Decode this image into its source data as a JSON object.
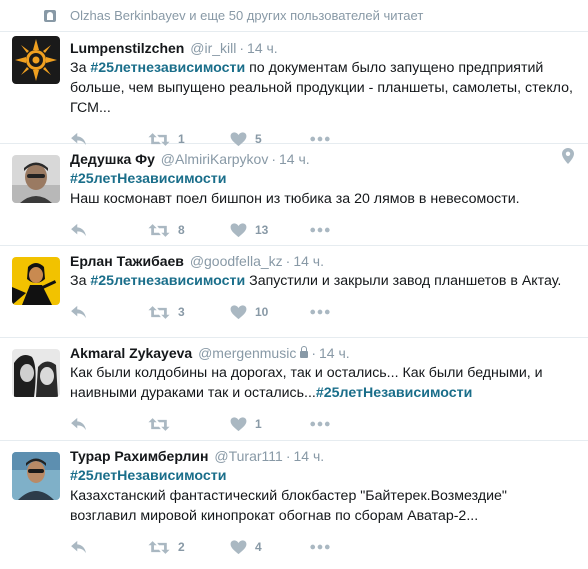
{
  "header": {
    "followers_text": "Olzhas Berkinbayev и еще 50 других пользователей читает"
  },
  "tweets": [
    {
      "name": "Lumpenstilzchen",
      "handle": "@ir_kill",
      "time": "14 ч.",
      "text_before": "За ",
      "hashtag": "#25летнезависимости",
      "text_after": " по документам было запущено предприятий больше, чем выпущено реальной продукции - планшеты, самолеты, стекло, ГСМ...",
      "retweets": "1",
      "likes": "5"
    },
    {
      "name": "Дедушка Фу",
      "handle": "@AlmiriKarpykov",
      "time": "14 ч.",
      "text_before": "",
      "hashtag": "#25летНезависимости",
      "text_after": "Наш космонавт поел бишпон из тюбика за 20 лямов в невесомости.",
      "retweets": "8",
      "likes": "13"
    },
    {
      "name": "Ерлан Тажибаев",
      "handle": "@goodfella_kz",
      "time": "14 ч.",
      "text_before": "За ",
      "hashtag": "#25летнезависимости",
      "text_after": " Запустили и закрыли завод планшетов в Актау.",
      "retweets": "3",
      "likes": "10"
    },
    {
      "name": "Akmaral Zykayeva",
      "handle": "@mergenmusic",
      "time": "14 ч.",
      "text_before": "Как были колдобины на дорогах, так и остались... Как были бедными, и наивными дураками так и остались...",
      "hashtag": "#25летНезависимости",
      "text_after": "",
      "retweets": "",
      "likes": "1"
    },
    {
      "name": "Турар Рахимберлин",
      "handle": "@Turar111",
      "time": "14 ч.",
      "text_before": "",
      "hashtag": "#25летНезависимости",
      "text_after": "Казахстанский фантастический блокбастер \"Байтерек.Возмездие\" возглавил мировой кинопрокат обогнав по сборам Аватар-2...",
      "retweets": "2",
      "likes": "4"
    }
  ]
}
